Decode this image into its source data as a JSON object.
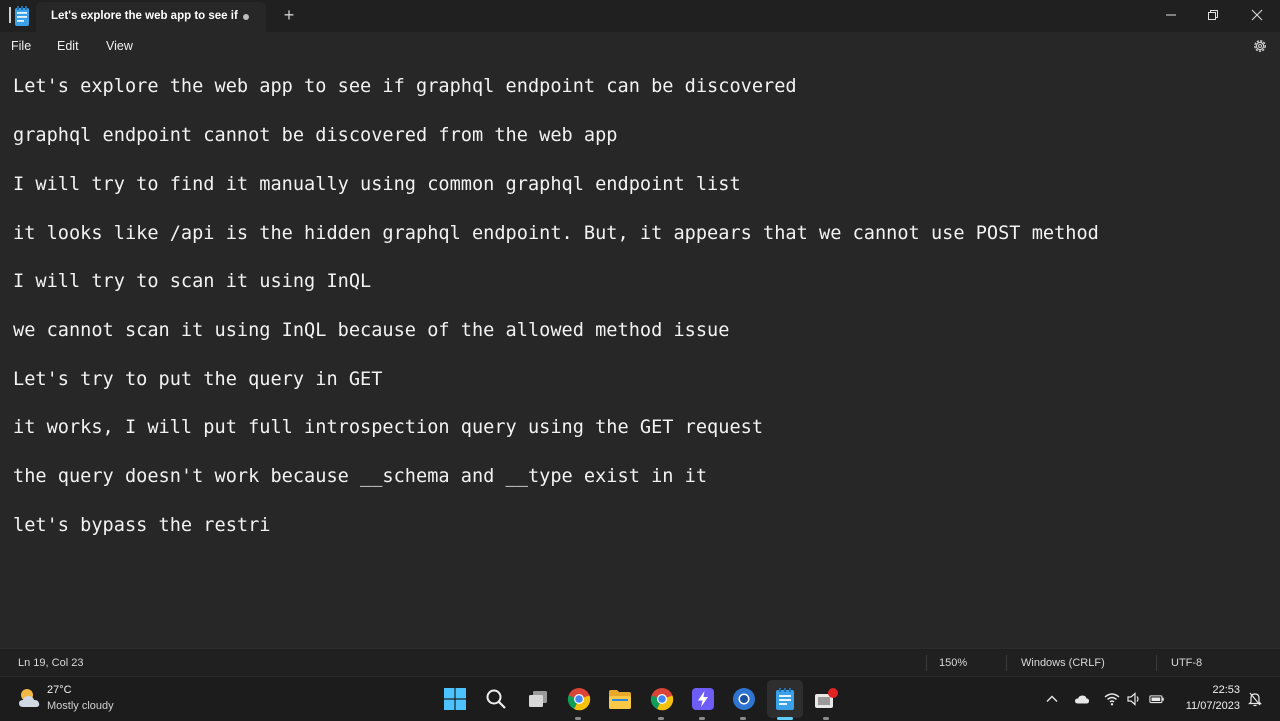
{
  "window": {
    "tab_title": "Let's explore the web app to see if",
    "new_tab": "+"
  },
  "menu": {
    "file": "File",
    "edit": "Edit",
    "view": "View"
  },
  "editor": {
    "lines": [
      "Let's explore the web app to see if graphql endpoint can be discovered",
      "graphql endpoint cannot be discovered from the web app",
      "I will try to find it manually using common graphql endpoint list",
      "it looks like /api is the hidden graphql endpoint. But, it appears that we cannot use POST method",
      "I will try to scan it using InQL",
      "we cannot scan it using InQL because of the allowed method issue",
      "Let's try to put the query in GET",
      "it works, I will put full introspection query using the GET request",
      "the query doesn't work because __schema and __type exist in it",
      "let's bypass the restri"
    ]
  },
  "status": {
    "position": "Ln 19, Col 23",
    "zoom": "150%",
    "line_endings": "Windows (CRLF)",
    "encoding": "UTF-8"
  },
  "taskbar": {
    "weather_temp": "27°C",
    "weather_desc": "Mostly cloudy",
    "time": "22:53",
    "date": "11/07/2023"
  },
  "colors": {
    "background": "#272727",
    "titlebar": "#202020",
    "text": "#f2f2f2",
    "accent": "#60cdff"
  }
}
